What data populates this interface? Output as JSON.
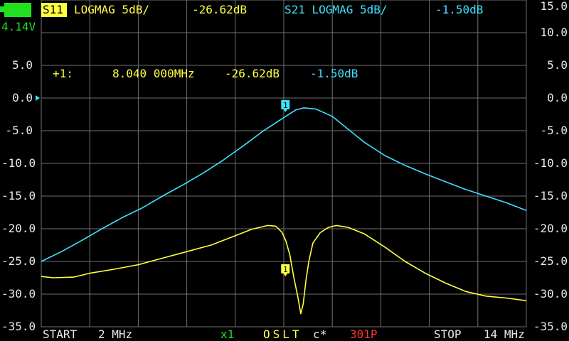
{
  "battery": {
    "voltage": "4.14V",
    "level": 1.0
  },
  "traces": {
    "s11": {
      "badge": "S11",
      "header": "LOGMAG 5dB/",
      "value": "-26.62dB",
      "color": "#ffff40"
    },
    "s21": {
      "header": "S21 LOGMAG 5dB/",
      "value": "-1.50dB",
      "color": "#40e0ff"
    }
  },
  "marker": {
    "label": "+1:",
    "frequency": "8.040 000MHz",
    "s11_value": "-26.62dB",
    "s21_value": "-1.50dB",
    "number": "1"
  },
  "axis": {
    "left_ticks": [
      "5.0",
      "0.0",
      "-5.0",
      "-10.0",
      "-15.0",
      "-20.0",
      "-25.0",
      "-30.0",
      "-35.0"
    ],
    "right_ticks": [
      "15.0",
      "10.0",
      "5.0",
      "0.0",
      "-5.0",
      "-10.0",
      "-15.0",
      "-20.0",
      "-25.0",
      "-30.0",
      "-35.0"
    ]
  },
  "footer": {
    "start_label": "START",
    "start_freq": "2 MHz",
    "zoom": "x1",
    "cal": "OSLT",
    "cal_flag": "c*",
    "points": "301P",
    "stop_label": "STOP",
    "stop_freq": "14 MHz"
  },
  "chart_data": {
    "type": "line",
    "x_unit": "MHz",
    "x_range": [
      2,
      14
    ],
    "y_unit": "dB",
    "ylim": [
      -35,
      15
    ],
    "y_per_div": 5,
    "grid": true,
    "series": [
      {
        "name": "S11",
        "color": "#ffff40",
        "points": [
          [
            2.0,
            -27.3
          ],
          [
            2.3,
            -27.5
          ],
          [
            2.8,
            -27.4
          ],
          [
            3.2,
            -26.8
          ],
          [
            3.8,
            -26.2
          ],
          [
            4.4,
            -25.5
          ],
          [
            5.0,
            -24.5
          ],
          [
            5.6,
            -23.5
          ],
          [
            6.2,
            -22.5
          ],
          [
            6.7,
            -21.3
          ],
          [
            7.2,
            -20.1
          ],
          [
            7.6,
            -19.5
          ],
          [
            7.8,
            -19.6
          ],
          [
            7.95,
            -20.5
          ],
          [
            8.05,
            -21.8
          ],
          [
            8.15,
            -24.0
          ],
          [
            8.25,
            -27.5
          ],
          [
            8.35,
            -30.5
          ],
          [
            8.42,
            -33.0
          ],
          [
            8.48,
            -31.5
          ],
          [
            8.55,
            -27.8
          ],
          [
            8.62,
            -25.0
          ],
          [
            8.72,
            -22.2
          ],
          [
            8.9,
            -20.6
          ],
          [
            9.1,
            -19.8
          ],
          [
            9.3,
            -19.5
          ],
          [
            9.6,
            -19.8
          ],
          [
            10.0,
            -20.8
          ],
          [
            10.5,
            -22.8
          ],
          [
            11.0,
            -25.0
          ],
          [
            11.5,
            -26.8
          ],
          [
            12.0,
            -28.3
          ],
          [
            12.5,
            -29.6
          ],
          [
            13.0,
            -30.3
          ],
          [
            13.5,
            -30.6
          ],
          [
            14.0,
            -31.0
          ]
        ]
      },
      {
        "name": "S21",
        "color": "#40e0ff",
        "points": [
          [
            2.0,
            -25.0
          ],
          [
            2.5,
            -23.5
          ],
          [
            3.0,
            -21.8
          ],
          [
            3.5,
            -20.0
          ],
          [
            4.0,
            -18.3
          ],
          [
            4.5,
            -16.8
          ],
          [
            5.0,
            -15.0
          ],
          [
            5.5,
            -13.3
          ],
          [
            6.0,
            -11.5
          ],
          [
            6.5,
            -9.5
          ],
          [
            7.0,
            -7.3
          ],
          [
            7.5,
            -5.0
          ],
          [
            8.0,
            -3.0
          ],
          [
            8.3,
            -1.8
          ],
          [
            8.5,
            -1.5
          ],
          [
            8.8,
            -1.7
          ],
          [
            9.2,
            -2.8
          ],
          [
            9.6,
            -4.8
          ],
          [
            10.0,
            -6.8
          ],
          [
            10.5,
            -8.8
          ],
          [
            11.0,
            -10.3
          ],
          [
            11.5,
            -11.6
          ],
          [
            12.0,
            -12.8
          ],
          [
            12.5,
            -14.0
          ],
          [
            13.0,
            -15.0
          ],
          [
            13.5,
            -16.0
          ],
          [
            14.0,
            -17.2
          ]
        ]
      }
    ],
    "markers": [
      {
        "series": "S11",
        "x": 8.04,
        "y": -26.62,
        "label": "1"
      },
      {
        "series": "S21",
        "x": 8.04,
        "y": -1.5,
        "label": "1"
      }
    ]
  }
}
